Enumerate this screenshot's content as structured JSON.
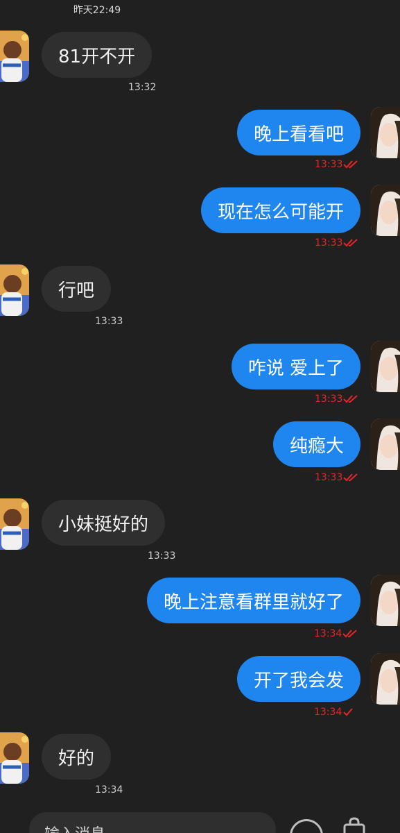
{
  "chat": {
    "previous_timestamp": "昨天22:49",
    "messages": [
      {
        "direction": "in",
        "text": "81开不开",
        "time": "13:32"
      },
      {
        "direction": "out",
        "text": "晚上看看吧",
        "time": "13:33",
        "status": "read"
      },
      {
        "direction": "out",
        "text": "现在怎么可能开",
        "time": "13:33",
        "status": "read"
      },
      {
        "direction": "in",
        "text": "行吧",
        "time": "13:33"
      },
      {
        "direction": "out",
        "text": "咋说 爱上了",
        "time": "13:33",
        "status": "read"
      },
      {
        "direction": "out",
        "text": "纯瘾大",
        "time": "13:33",
        "status": "read"
      },
      {
        "direction": "in",
        "text": "小妹挺好的",
        "time": "13:33"
      },
      {
        "direction": "out",
        "text": "晚上注意看群里就好了",
        "time": "13:34",
        "status": "read"
      },
      {
        "direction": "out",
        "text": "开了我会发",
        "time": "13:34",
        "status": "sent"
      },
      {
        "direction": "in",
        "text": "好的",
        "time": "13:34"
      }
    ]
  },
  "composer": {
    "placeholder": "输入消息",
    "icons": [
      "emoji-icon",
      "shopping-bag-icon"
    ]
  },
  "colors": {
    "background": "#202020",
    "incoming_bubble": "#2f2f2f",
    "outgoing_bubble": "#1f86f0",
    "outgoing_time": "#e8262a"
  }
}
